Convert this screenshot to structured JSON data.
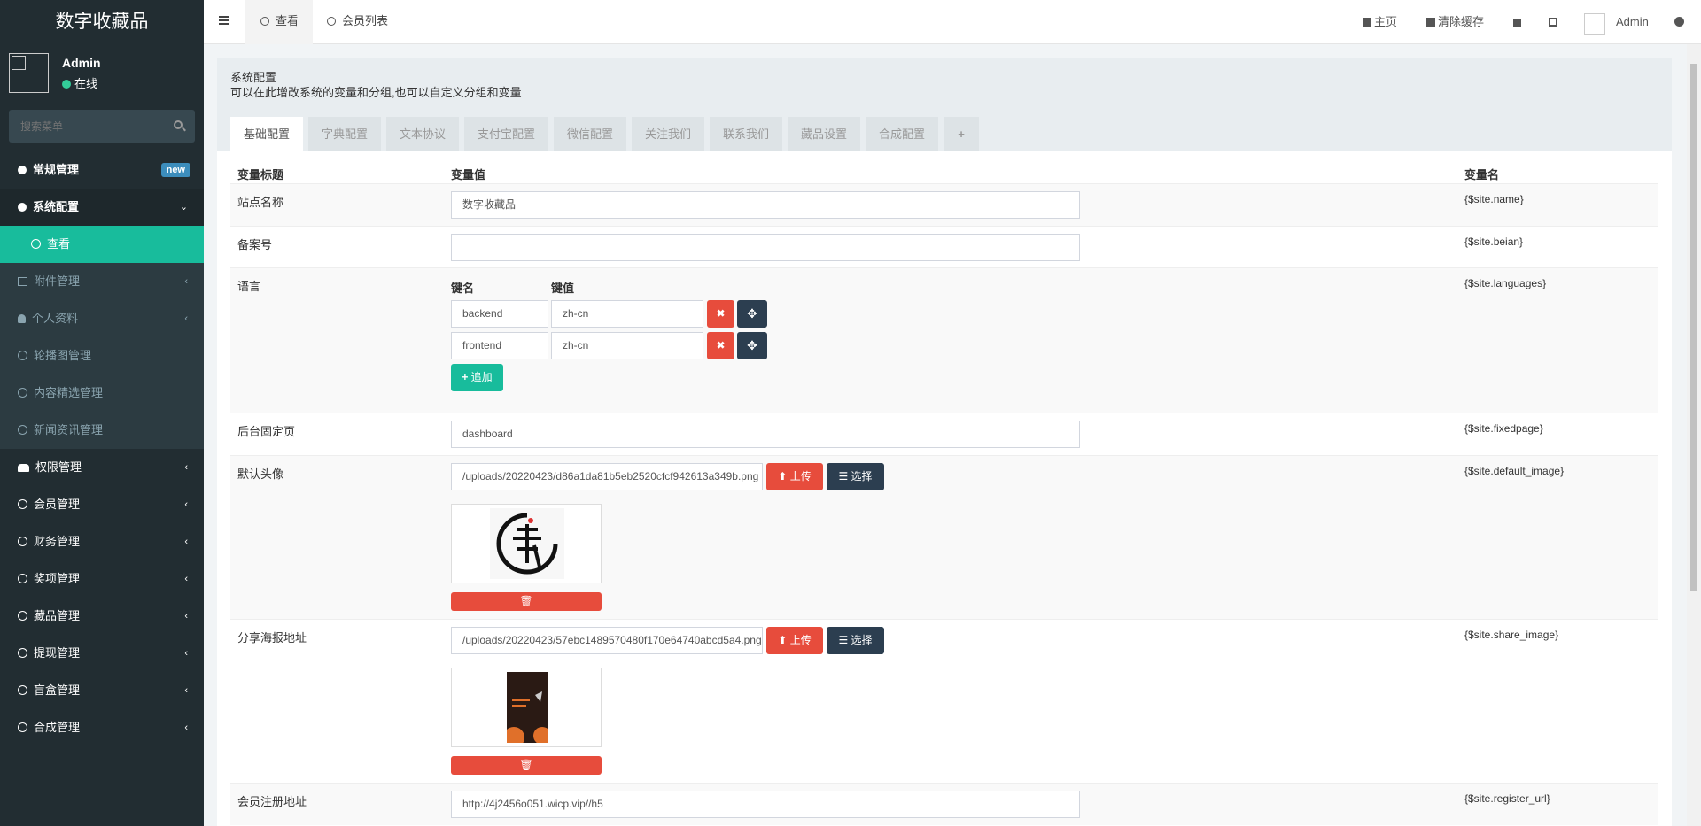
{
  "app": {
    "title": "数字收藏品"
  },
  "user": {
    "name": "Admin",
    "status": "在线"
  },
  "search": {
    "placeholder": "搜索菜单"
  },
  "menu": {
    "general": "常规管理",
    "general_badge": "new",
    "sysconfig": "系统配置",
    "view": "查看",
    "attachments": "附件管理",
    "profile": "个人资料",
    "carousel": "轮播图管理",
    "curation": "内容精选管理",
    "news": "新闻资讯管理",
    "auth": "权限管理",
    "members": "会员管理",
    "finance": "财务管理",
    "prizes": "奖项管理",
    "collections": "藏品管理",
    "withdraw": "提现管理",
    "blindbox": "盲盒管理",
    "synthesis": "合成管理"
  },
  "topnav": {
    "tab_view": "查看",
    "tab_members": "会员列表",
    "home": "主页",
    "clear_cache": "清除缓存",
    "admin": "Admin"
  },
  "panel": {
    "title": "系统配置",
    "description": "可以在此增改系统的变量和分组,也可以自定义分组和变量",
    "tabs": [
      "基础配置",
      "字典配置",
      "文本协议",
      "支付宝配置",
      "微信配置",
      "关注我们",
      "联系我们",
      "藏品设置",
      "合成配置",
      "+"
    ]
  },
  "table": {
    "headers": {
      "title": "变量标题",
      "value": "变量值",
      "name": "变量名"
    },
    "kv_headers": {
      "key": "键名",
      "value": "键值"
    },
    "rows": {
      "site_name": {
        "label": "站点名称",
        "value": "数字收藏品",
        "var": "{$site.name}"
      },
      "beian": {
        "label": "备案号",
        "value": "",
        "var": "{$site.beian}"
      },
      "languages": {
        "label": "语言",
        "var": "{$site.languages}",
        "items": [
          {
            "key": "backend",
            "value": "zh-cn"
          },
          {
            "key": "frontend",
            "value": "zh-cn"
          }
        ],
        "add_label": "追加"
      },
      "fixedpage": {
        "label": "后台固定页",
        "value": "dashboard",
        "var": "{$site.fixedpage}"
      },
      "default_image": {
        "label": "默认头像",
        "value": "/uploads/20220423/d86a1da81b5eb2520cfcf942613a349b.png",
        "var": "{$site.default_image}"
      },
      "share_image": {
        "label": "分享海报地址",
        "value": "/uploads/20220423/57ebc1489570480f170e64740abcd5a4.png",
        "var": "{$site.share_image}"
      },
      "register_url": {
        "label": "会员注册地址",
        "value": "http://4j2456o051.wicp.vip//h5",
        "var": "{$site.register_url}"
      }
    },
    "upload_label": "上传",
    "choose_label": "选择"
  },
  "colors": {
    "sidebar": "#222d32",
    "accent": "#18bc9c",
    "danger": "#e74c3c",
    "dark": "#2c3e50"
  }
}
